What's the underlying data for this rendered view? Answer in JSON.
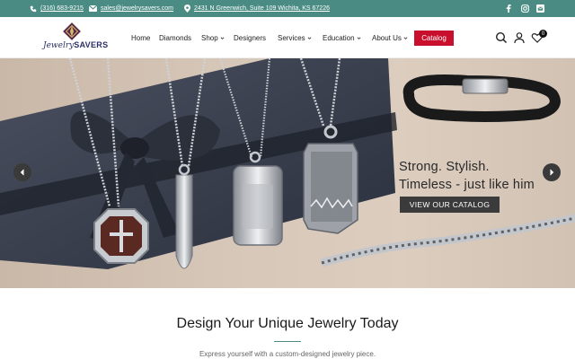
{
  "topbar": {
    "phone": "(316) 683-9215",
    "email": "sales@jewelrysavers.com",
    "address": "2431 N Greenwich, Suite 109 Wichita, KS 67226"
  },
  "brand": {
    "script_name": "Jewelry",
    "bold_name": "SAVERS"
  },
  "nav": {
    "items": [
      "Home",
      "Diamonds",
      "Shop",
      "Designers",
      "Services",
      "Education",
      "About Us"
    ],
    "catalog_label": "Catalog",
    "cart_count": "0"
  },
  "hero": {
    "line1": "Strong. Stylish.",
    "line2": "Timeless - just like him",
    "cta": "VIEW OUR CATALOG"
  },
  "section": {
    "title": "Design Your Unique Jewelry Today",
    "subtitle": "Express yourself with a custom-designed jewelry piece."
  },
  "colors": {
    "topbar": "#4a8c83",
    "catalog": "#c8102e",
    "hero_button": "#3b3b3b",
    "brand_navy": "#2b2f66"
  }
}
